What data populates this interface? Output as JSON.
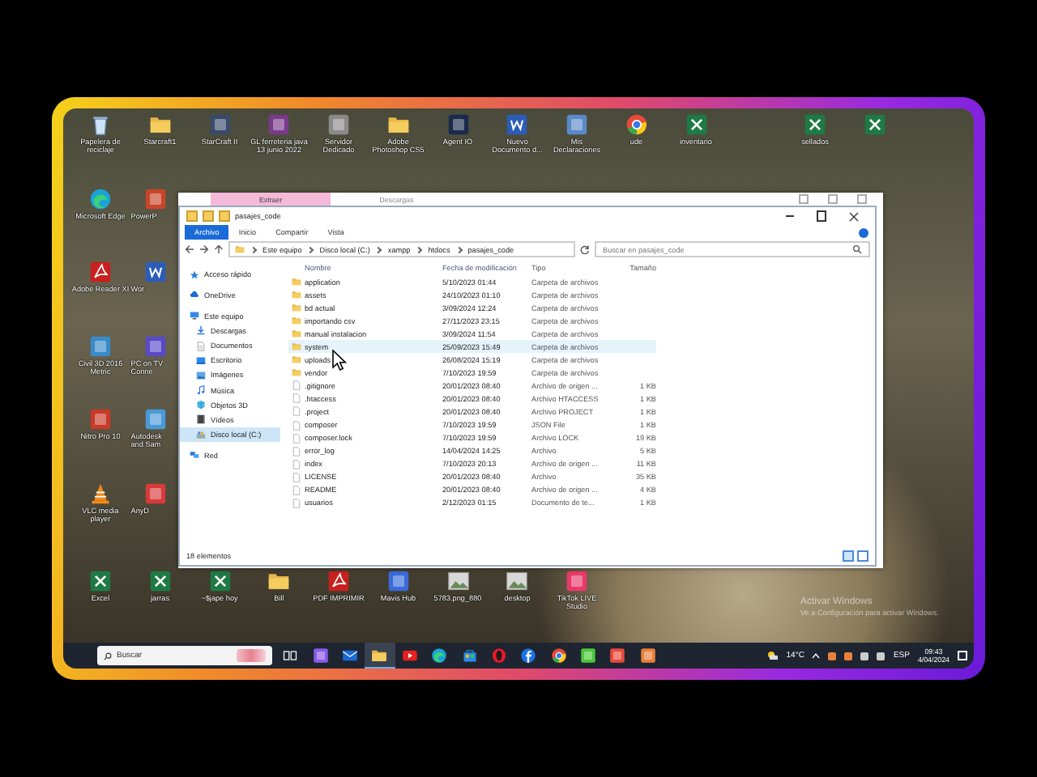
{
  "desktop": {
    "icon_rows": [
      [
        {
          "label": "Papelera de reciclaje",
          "kind": "recycle"
        },
        {
          "label": "Starcraft1",
          "kind": "folder"
        },
        {
          "label": "StarCraft II",
          "kind": "tile",
          "color": "#3a4a6a"
        },
        {
          "label": "GL ferreteria java 13 junio 2022",
          "kind": "tile",
          "color": "#7a3a8a"
        },
        {
          "label": "Servidor Dedicado",
          "kind": "tile",
          "color": "#8a8a8a"
        },
        {
          "label": "Adobe Photoshop CS5",
          "kind": "folder"
        },
        {
          "label": "Agent IO",
          "kind": "tile",
          "color": "#1a2a4a"
        },
        {
          "label": "Nuevo Documento d...",
          "kind": "word"
        },
        {
          "label": "Mis Declaraciones",
          "kind": "tile",
          "color": "#5a8ac8"
        },
        {
          "label": "ude",
          "kind": "chrome"
        },
        {
          "label": "inventario",
          "kind": "excel"
        },
        {
          "label": "sellados",
          "kind": "excel"
        },
        {
          "kind": "excel"
        }
      ],
      [
        {
          "label": "Microsoft Edge",
          "kind": "edge"
        },
        {
          "label": "PowerP",
          "kind": "tile",
          "color": "#c8452a"
        }
      ],
      [
        {
          "label": "Adobe Reader XI",
          "kind": "pdf"
        },
        {
          "label": "Wor",
          "kind": "word"
        }
      ],
      [
        {
          "label": "Civil 3D 2016 Metric",
          "kind": "tile",
          "color": "#3a8ac8"
        },
        {
          "label": "PC on TV Conne",
          "kind": "tile",
          "color": "#5a4ac8"
        }
      ],
      [
        {
          "label": "Nitro Pro 10",
          "kind": "tile",
          "color": "#c83a2a"
        },
        {
          "label": "Autodesk and Sam",
          "kind": "tile",
          "color": "#4a9ad8"
        }
      ],
      [
        {
          "label": "VLC media player",
          "kind": "vlc"
        },
        {
          "label": "AnyD",
          "kind": "tile",
          "color": "#d83a3a"
        }
      ],
      [
        {
          "label": "Excel",
          "kind": "excel"
        },
        {
          "label": "jarras",
          "kind": "excel"
        },
        {
          "label": "~$jape hoy",
          "kind": "excel"
        },
        {
          "label": "Bill",
          "kind": "folder"
        },
        {
          "label": "PDF IMPRIMIR",
          "kind": "pdf"
        },
        {
          "label": "Mavis Hub",
          "kind": "tile",
          "color": "#3a6ad8"
        },
        {
          "label": "5783.png_880",
          "kind": "image"
        },
        {
          "label": "desktop",
          "kind": "image"
        },
        {
          "label": "TikTok LIVE Studio",
          "kind": "tile",
          "color": "#e83a6a"
        }
      ]
    ],
    "activation_notice": {
      "title": "Activar Windows",
      "text": "Ve a Configuración para activar Windows."
    }
  },
  "back_window": {
    "tabs": [
      {
        "label": "Extraer",
        "selected": true
      },
      {
        "label": "Descargas",
        "selected": false
      }
    ]
  },
  "explorer": {
    "title": "pasajes_code",
    "ribbon_tabs": [
      {
        "label": "Archivo",
        "selected": true
      },
      {
        "label": "Inicio",
        "selected": false
      },
      {
        "label": "Compartir",
        "selected": false
      },
      {
        "label": "Vista",
        "selected": false
      }
    ],
    "path": [
      "Este equipo",
      "Disco local (C:)",
      "xampp",
      "htdocs",
      "pasajes_code"
    ],
    "search": {
      "placeholder": "Buscar en pasajes_code"
    },
    "nav": [
      {
        "label": "Acceso rápido",
        "kind": "star",
        "selected": false
      },
      {
        "label": "OneDrive",
        "kind": "cloud",
        "selected": false
      },
      {
        "label": "Este equipo",
        "kind": "computer",
        "selected": false,
        "children": [
          {
            "label": "Descargas",
            "kind": "download",
            "selected": false
          },
          {
            "label": "Documentos",
            "kind": "docs",
            "selected": false
          },
          {
            "label": "Escritorio",
            "kind": "desktop",
            "selected": false
          },
          {
            "label": "Imágenes",
            "kind": "images",
            "selected": false
          },
          {
            "label": "Música",
            "kind": "music",
            "selected": false
          },
          {
            "label": "Objetos 3D",
            "kind": "cube",
            "selected": false
          },
          {
            "label": "Vídeos",
            "kind": "video",
            "selected": false
          },
          {
            "label": "Disco local (C:)",
            "kind": "drive",
            "selected": true
          }
        ]
      },
      {
        "label": "Red",
        "kind": "network",
        "selected": false
      }
    ],
    "columns": [
      "Nombre",
      "Fecha de modificación",
      "Tipo",
      "Tamaño"
    ],
    "rows": [
      {
        "name": "application",
        "date": "5/10/2023 01:44",
        "type": "Carpeta de archivos",
        "kind": "folder",
        "selected": false
      },
      {
        "name": "assets",
        "date": "24/10/2023 01:10",
        "type": "Carpeta de archivos",
        "kind": "folder",
        "selected": false
      },
      {
        "name": "bd actual",
        "date": "3/09/2024 12:24",
        "type": "Carpeta de archivos",
        "kind": "folder",
        "selected": false
      },
      {
        "name": "importando csv",
        "date": "27/11/2023 23:15",
        "type": "Carpeta de archivos",
        "kind": "folder",
        "selected": false
      },
      {
        "name": "manual instalacion",
        "date": "3/09/2024 11:54",
        "type": "Carpeta de archivos",
        "kind": "folder",
        "selected": false
      },
      {
        "name": "system",
        "date": "25/09/2023 15:49",
        "type": "Carpeta de archivos",
        "kind": "folder",
        "selected": true
      },
      {
        "name": "uploads",
        "date": "26/08/2024 15:19",
        "type": "Carpeta de archivos",
        "kind": "folder",
        "selected": false
      },
      {
        "name": "vendor",
        "date": "7/10/2023 19:59",
        "type": "Carpeta de archivos",
        "kind": "folder",
        "selected": false
      },
      {
        "name": ".gitignore",
        "date": "20/01/2023 08:40",
        "type": "Archivo de origen ...",
        "size": "1 KB",
        "kind": "file",
        "selected": false
      },
      {
        "name": ".htaccess",
        "date": "20/01/2023 08:40",
        "type": "Archivo HTACCESS",
        "size": "1 KB",
        "kind": "file",
        "selected": false
      },
      {
        "name": ".project",
        "date": "20/01/2023 08:40",
        "type": "Archivo PROJECT",
        "size": "1 KB",
        "kind": "file",
        "selected": false
      },
      {
        "name": "composer",
        "date": "7/10/2023 19:59",
        "type": "JSON File",
        "size": "1 KB",
        "kind": "file",
        "selected": false
      },
      {
        "name": "composer.lock",
        "date": "7/10/2023 19:59",
        "type": "Archivo LOCK",
        "size": "19 KB",
        "kind": "file",
        "selected": false
      },
      {
        "name": "error_log",
        "date": "14/04/2024 14:25",
        "type": "Archivo",
        "size": "5 KB",
        "kind": "file",
        "selected": false
      },
      {
        "name": "index",
        "date": "7/10/2023 20:13",
        "type": "Archivo de origen ...",
        "size": "11 KB",
        "kind": "file",
        "selected": false
      },
      {
        "name": "LICENSE",
        "date": "20/01/2023 08:40",
        "type": "Archivo",
        "size": "35 KB",
        "kind": "file",
        "selected": false
      },
      {
        "name": "README",
        "date": "20/01/2023 08:40",
        "type": "Archivo de origen ...",
        "size": "4 KB",
        "kind": "file",
        "selected": false
      },
      {
        "name": "usuarios",
        "date": "2/12/2023 01:15",
        "type": "Documento de te...",
        "size": "1 KB",
        "kind": "file",
        "selected": false
      }
    ],
    "status": "18 elementos"
  },
  "taskbar": {
    "search": {
      "placeholder": "Buscar"
    },
    "apps": [
      {
        "kind": "taskview",
        "selected": false
      },
      {
        "kind": "tile",
        "color": "#8a5ae8",
        "selected": false
      },
      {
        "kind": "mail",
        "selected": false
      },
      {
        "kind": "folder",
        "selected": true
      },
      {
        "kind": "video",
        "selected": false
      },
      {
        "kind": "edge",
        "selected": false
      },
      {
        "kind": "store",
        "selected": false
      },
      {
        "kind": "opera",
        "selected": false
      },
      {
        "kind": "facebook",
        "selected": false
      },
      {
        "kind": "chrome",
        "selected": false
      },
      {
        "kind": "tile",
        "color": "#4ac83a",
        "selected": false
      },
      {
        "kind": "tile",
        "color": "#e84a3a",
        "selected": false
      },
      {
        "kind": "tile",
        "color": "#e8803a",
        "selected": false
      }
    ],
    "weather": "14°C",
    "language": "ESP",
    "time": "09:43",
    "date": "4/04/2024"
  }
}
